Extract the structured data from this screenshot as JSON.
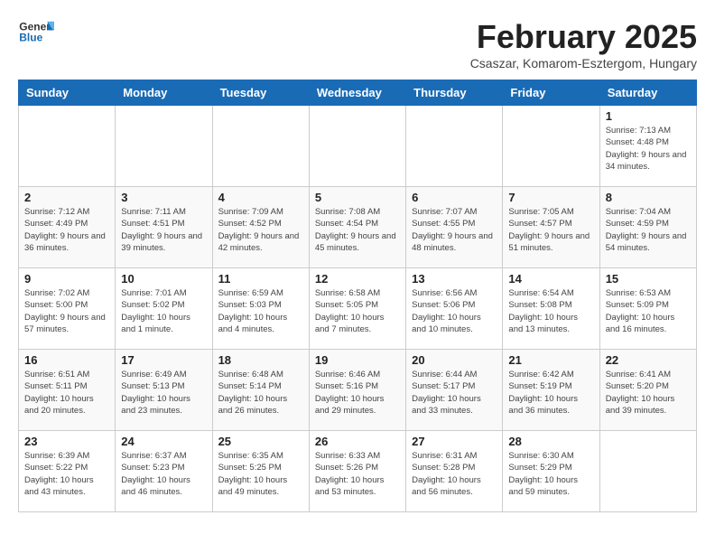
{
  "logo": {
    "general": "General",
    "blue": "Blue"
  },
  "title": "February 2025",
  "subtitle": "Csaszar, Komarom-Esztergom, Hungary",
  "weekdays": [
    "Sunday",
    "Monday",
    "Tuesday",
    "Wednesday",
    "Thursday",
    "Friday",
    "Saturday"
  ],
  "weeks": [
    [
      {
        "day": "",
        "info": ""
      },
      {
        "day": "",
        "info": ""
      },
      {
        "day": "",
        "info": ""
      },
      {
        "day": "",
        "info": ""
      },
      {
        "day": "",
        "info": ""
      },
      {
        "day": "",
        "info": ""
      },
      {
        "day": "1",
        "info": "Sunrise: 7:13 AM\nSunset: 4:48 PM\nDaylight: 9 hours and 34 minutes."
      }
    ],
    [
      {
        "day": "2",
        "info": "Sunrise: 7:12 AM\nSunset: 4:49 PM\nDaylight: 9 hours and 36 minutes."
      },
      {
        "day": "3",
        "info": "Sunrise: 7:11 AM\nSunset: 4:51 PM\nDaylight: 9 hours and 39 minutes."
      },
      {
        "day": "4",
        "info": "Sunrise: 7:09 AM\nSunset: 4:52 PM\nDaylight: 9 hours and 42 minutes."
      },
      {
        "day": "5",
        "info": "Sunrise: 7:08 AM\nSunset: 4:54 PM\nDaylight: 9 hours and 45 minutes."
      },
      {
        "day": "6",
        "info": "Sunrise: 7:07 AM\nSunset: 4:55 PM\nDaylight: 9 hours and 48 minutes."
      },
      {
        "day": "7",
        "info": "Sunrise: 7:05 AM\nSunset: 4:57 PM\nDaylight: 9 hours and 51 minutes."
      },
      {
        "day": "8",
        "info": "Sunrise: 7:04 AM\nSunset: 4:59 PM\nDaylight: 9 hours and 54 minutes."
      }
    ],
    [
      {
        "day": "9",
        "info": "Sunrise: 7:02 AM\nSunset: 5:00 PM\nDaylight: 9 hours and 57 minutes."
      },
      {
        "day": "10",
        "info": "Sunrise: 7:01 AM\nSunset: 5:02 PM\nDaylight: 10 hours and 1 minute."
      },
      {
        "day": "11",
        "info": "Sunrise: 6:59 AM\nSunset: 5:03 PM\nDaylight: 10 hours and 4 minutes."
      },
      {
        "day": "12",
        "info": "Sunrise: 6:58 AM\nSunset: 5:05 PM\nDaylight: 10 hours and 7 minutes."
      },
      {
        "day": "13",
        "info": "Sunrise: 6:56 AM\nSunset: 5:06 PM\nDaylight: 10 hours and 10 minutes."
      },
      {
        "day": "14",
        "info": "Sunrise: 6:54 AM\nSunset: 5:08 PM\nDaylight: 10 hours and 13 minutes."
      },
      {
        "day": "15",
        "info": "Sunrise: 6:53 AM\nSunset: 5:09 PM\nDaylight: 10 hours and 16 minutes."
      }
    ],
    [
      {
        "day": "16",
        "info": "Sunrise: 6:51 AM\nSunset: 5:11 PM\nDaylight: 10 hours and 20 minutes."
      },
      {
        "day": "17",
        "info": "Sunrise: 6:49 AM\nSunset: 5:13 PM\nDaylight: 10 hours and 23 minutes."
      },
      {
        "day": "18",
        "info": "Sunrise: 6:48 AM\nSunset: 5:14 PM\nDaylight: 10 hours and 26 minutes."
      },
      {
        "day": "19",
        "info": "Sunrise: 6:46 AM\nSunset: 5:16 PM\nDaylight: 10 hours and 29 minutes."
      },
      {
        "day": "20",
        "info": "Sunrise: 6:44 AM\nSunset: 5:17 PM\nDaylight: 10 hours and 33 minutes."
      },
      {
        "day": "21",
        "info": "Sunrise: 6:42 AM\nSunset: 5:19 PM\nDaylight: 10 hours and 36 minutes."
      },
      {
        "day": "22",
        "info": "Sunrise: 6:41 AM\nSunset: 5:20 PM\nDaylight: 10 hours and 39 minutes."
      }
    ],
    [
      {
        "day": "23",
        "info": "Sunrise: 6:39 AM\nSunset: 5:22 PM\nDaylight: 10 hours and 43 minutes."
      },
      {
        "day": "24",
        "info": "Sunrise: 6:37 AM\nSunset: 5:23 PM\nDaylight: 10 hours and 46 minutes."
      },
      {
        "day": "25",
        "info": "Sunrise: 6:35 AM\nSunset: 5:25 PM\nDaylight: 10 hours and 49 minutes."
      },
      {
        "day": "26",
        "info": "Sunrise: 6:33 AM\nSunset: 5:26 PM\nDaylight: 10 hours and 53 minutes."
      },
      {
        "day": "27",
        "info": "Sunrise: 6:31 AM\nSunset: 5:28 PM\nDaylight: 10 hours and 56 minutes."
      },
      {
        "day": "28",
        "info": "Sunrise: 6:30 AM\nSunset: 5:29 PM\nDaylight: 10 hours and 59 minutes."
      },
      {
        "day": "",
        "info": ""
      }
    ]
  ]
}
